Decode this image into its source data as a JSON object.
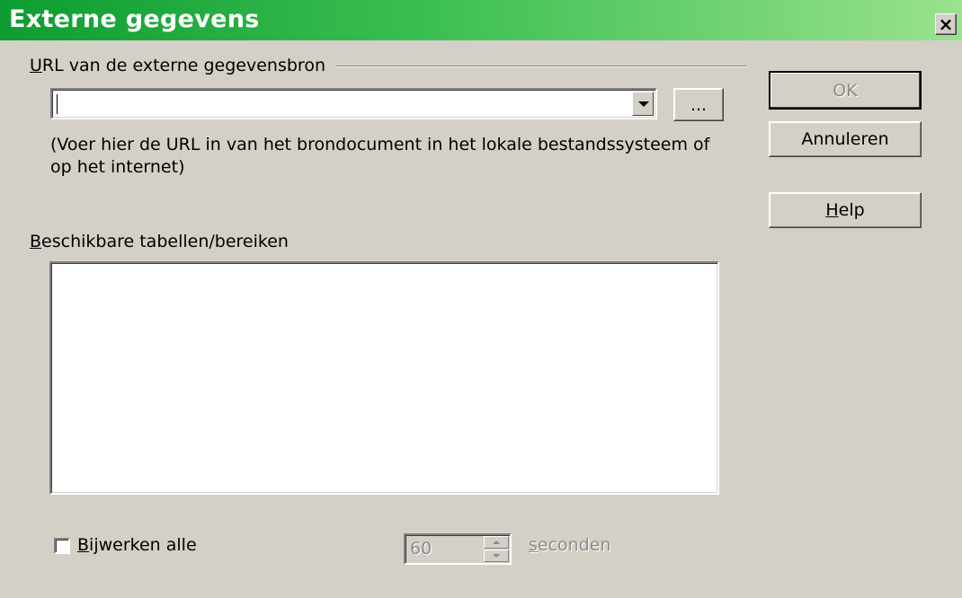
{
  "window": {
    "title": "Externe gegevens",
    "close_label": "×"
  },
  "url_group": {
    "label": "URL van de externe gegevensbron",
    "input_value": "",
    "browse_label": "...",
    "hint_line1": "(Voer hier de URL in van het brondocument in het lokale bestandssysteem of",
    "hint_line2": "op het internet)"
  },
  "tables": {
    "label": "Beschikbare tabellen/bereiken",
    "items": []
  },
  "refresh": {
    "checkbox_label": "Bijwerken alle",
    "checked": false,
    "interval_value": "60",
    "unit_label": "seconden"
  },
  "buttons": {
    "ok": "OK",
    "cancel": "Annuleren",
    "help": "Help"
  },
  "colors": {
    "titlebar_start": "#0e9c30",
    "titlebar_end": "#9ae28e",
    "dialog_bg": "#d4d0c8"
  }
}
